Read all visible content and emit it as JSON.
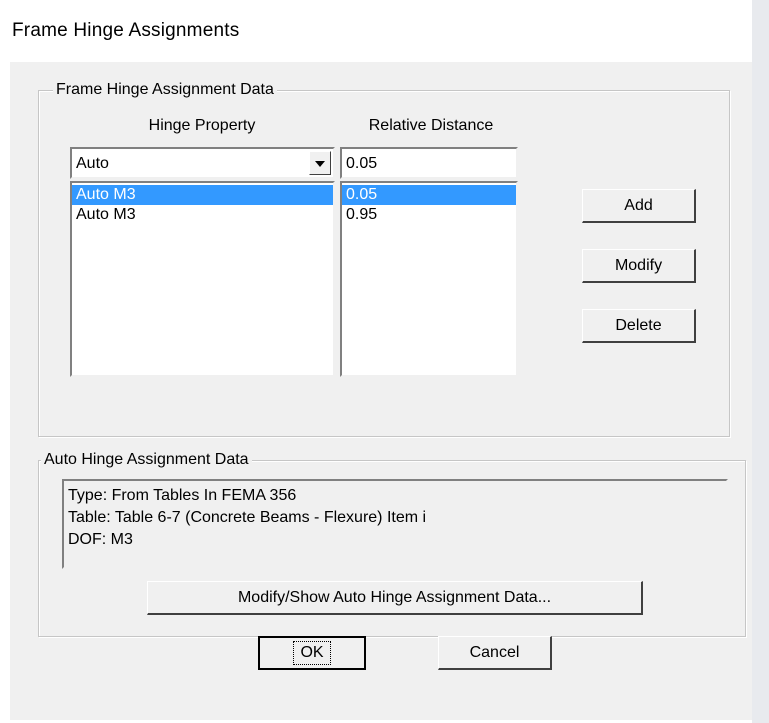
{
  "window": {
    "title": "Frame Hinge Assignments"
  },
  "frame_hinge_group": {
    "legend": "Frame Hinge Assignment Data",
    "hinge_property_header": "Hinge Property",
    "relative_distance_header": "Relative Distance",
    "hinge_property_combo_value": "Auto",
    "relative_distance_input_value": "0.05",
    "hinge_property_list": [
      "Auto  M3",
      "Auto  M3"
    ],
    "relative_distance_list": [
      "0.05",
      "0.95"
    ],
    "selected_row_index": 0,
    "add_label": "Add",
    "modify_label": "Modify",
    "delete_label": "Delete"
  },
  "auto_hinge_group": {
    "legend": "Auto Hinge Assignment Data",
    "lines": [
      "Type:  From Tables In FEMA 356",
      "Table:  Table 6-7 (Concrete Beams - Flexure) Item i",
      "DOF:  M3"
    ],
    "modify_show_label": "Modify/Show Auto Hinge Assignment Data..."
  },
  "footer": {
    "ok_label": "OK",
    "cancel_label": "Cancel"
  },
  "colors": {
    "selection": "#3399ff",
    "dialog_face": "#f0f0f0"
  }
}
